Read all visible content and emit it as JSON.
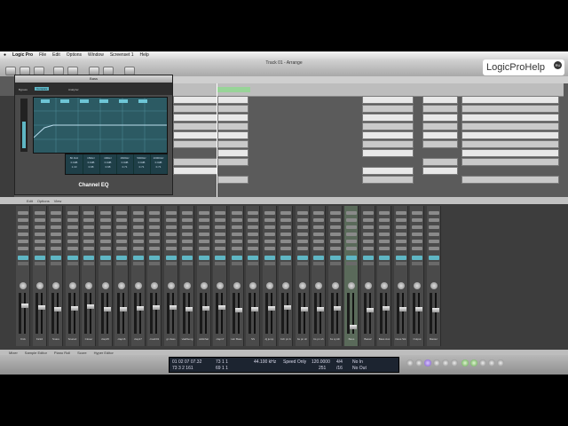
{
  "menubar": {
    "apple": "",
    "items": [
      "Logic Pro",
      "File",
      "Edit",
      "Options",
      "Window",
      "Screenset 1",
      "Help"
    ]
  },
  "window": {
    "title": "Track 01 - Arrange"
  },
  "watermark": {
    "text": "LogicProHelp",
    "badge": "RU"
  },
  "eq": {
    "window_title": "Bass",
    "label": "Channel EQ",
    "tabs": [
      "Bypass",
      "Compare",
      "Analyzer"
    ],
    "bands": [
      {
        "freq": "80.0Hz",
        "gain": "0.0dB",
        "q": "1.10"
      },
      {
        "freq": "150Hz",
        "gain": "0.0dB",
        "q": "0.98"
      },
      {
        "freq": "400Hz",
        "gain": "0.0dB",
        "q": "0.98"
      },
      {
        "freq": "1600Hz",
        "gain": "0.0dB",
        "q": "0.71"
      },
      {
        "freq": "5000Hz",
        "gain": "0.0dB",
        "q": "0.71"
      },
      {
        "freq": "10000Hz",
        "gain": "0.0dB",
        "q": "0.71"
      }
    ]
  },
  "mixer": {
    "header": [
      "Edit",
      "Options",
      "View"
    ],
    "channels": [
      {
        "name": "Kick"
      },
      {
        "name": "Kick2"
      },
      {
        "name": "Snare"
      },
      {
        "name": "Snare2"
      },
      {
        "name": "Closer"
      },
      {
        "name": "clap15"
      },
      {
        "name": "clap16"
      },
      {
        "name": "clap17"
      },
      {
        "name": "crash01"
      },
      {
        "name": "gt class"
      },
      {
        "name": "vla&Seng"
      },
      {
        "name": "oldHihat"
      },
      {
        "name": "clap17"
      },
      {
        "name": "Hor Bass"
      },
      {
        "name": "SS"
      },
      {
        "name": "dj jump"
      },
      {
        "name": "bch pn b"
      },
      {
        "name": "bs pn sh"
      },
      {
        "name": "bs pn sh"
      },
      {
        "name": "bs synth"
      },
      {
        "name": "Bass"
      },
      {
        "name": "Bass2"
      },
      {
        "name": "Bass Aux"
      },
      {
        "name": "Dess Stk"
      },
      {
        "name": "Output"
      },
      {
        "name": "Master"
      }
    ]
  },
  "statusbar": [
    "Mixer",
    "Sample Editor",
    "Piano Roll",
    "Score",
    "Hyper Editor"
  ],
  "transport": {
    "position_bars": "01 02 07 07.32",
    "position_sub": "73 3 2 161",
    "locator_l": "73 1 1",
    "locator_r": "69 1 1",
    "sample_rate": "44.100 kHz",
    "mode": "Speed Only",
    "tempo": "120.0000",
    "tempo_sub": "251",
    "signature": "4/4",
    "division": "/16",
    "midi_in": "No In",
    "midi_out": "No Out"
  },
  "colors": {
    "plugin": "#5fb6c4",
    "cycle": "#8fd98f",
    "eq_bg": "#2c5a63"
  }
}
